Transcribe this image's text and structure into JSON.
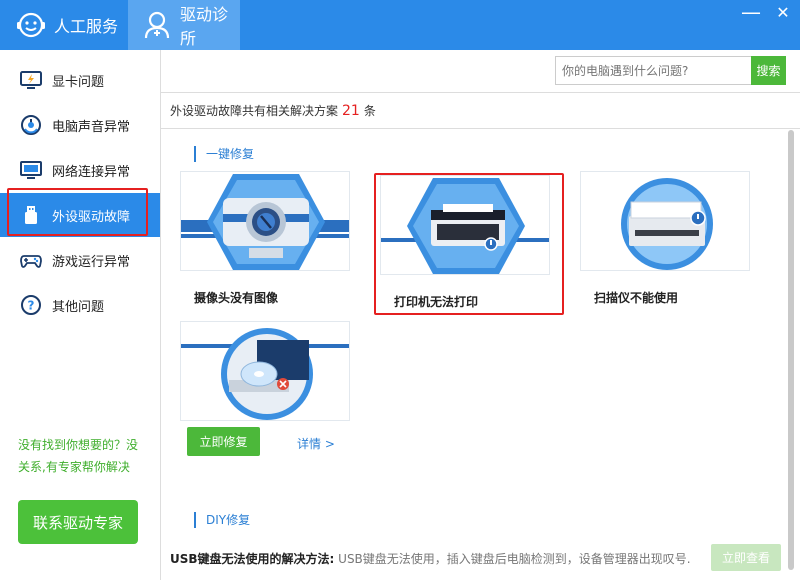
{
  "titlebar": {
    "tabs": [
      {
        "label": "人工服务",
        "icon": "headset-icon"
      },
      {
        "label": "驱动诊所",
        "icon": "doctor-icon"
      }
    ],
    "controls": {
      "minimize": "—",
      "close": "✕"
    }
  },
  "sidebar": {
    "items": [
      {
        "label": "显卡问题",
        "icon": "gpu-icon"
      },
      {
        "label": "电脑声音异常",
        "icon": "speaker-icon"
      },
      {
        "label": "网络连接异常",
        "icon": "monitor-icon"
      },
      {
        "label": "外设驱动故障",
        "icon": "usb-icon",
        "active": true
      },
      {
        "label": "游戏运行异常",
        "icon": "gamepad-icon"
      },
      {
        "label": "其他问题",
        "icon": "question-icon"
      }
    ],
    "hint": "没有找到你想要的？没关系,有专家帮你解决",
    "contact_label": "联系驱动专家"
  },
  "search": {
    "placeholder": "你的电脑遇到什么问题?",
    "button_label": "搜索"
  },
  "summary": {
    "prefix": "外设驱动故障共有相关解决方案",
    "count": "21",
    "suffix": "条"
  },
  "sections": {
    "one_click": "一键修复",
    "diy": "DIY修复"
  },
  "cards": [
    {
      "label": "摄像头没有图像",
      "icon": "webcam-icon"
    },
    {
      "label": "打印机无法打印",
      "icon": "printer-icon"
    },
    {
      "label": "扫描仪不能使用",
      "icon": "scanner-icon"
    },
    {
      "label": "",
      "icon": "disc-drive-icon"
    }
  ],
  "actions": {
    "fix_label": "立即修复",
    "detail_label": "详情 >"
  },
  "diy": {
    "title": "USB键盘无法使用的解决方法:",
    "text": " USB键盘无法使用，插入键盘后电脑检测到，设备管理器出现叹号...",
    "view_label": "立即查看"
  },
  "colors": {
    "primary": "#2b8ae8",
    "green": "#4cb83a",
    "highlight": "#e52020"
  }
}
